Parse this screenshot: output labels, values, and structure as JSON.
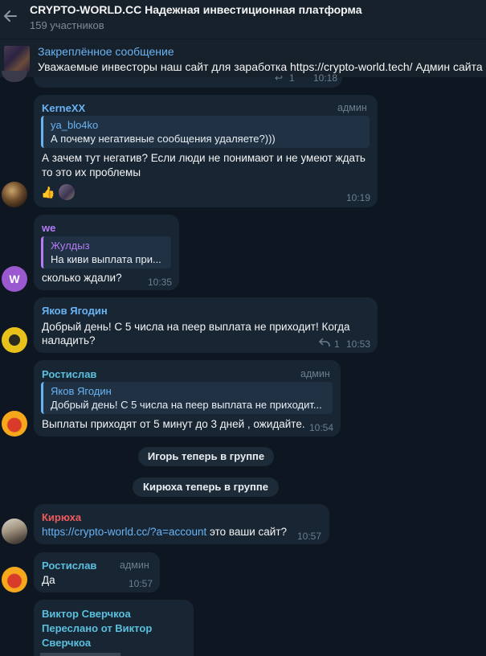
{
  "header": {
    "title": "CRYPTO-WORLD.CC Надежная инвестиционная платформа",
    "subtitle": "159 участников"
  },
  "pinned": {
    "title": "Закреплённое сообщение",
    "text": "Уважаемые инвесторы наш сайт для заработка https://crypto-world.tech/ Админ сайта https://"
  },
  "messages": {
    "top_partial": {
      "reply_count": "1",
      "time": "10:18"
    },
    "m1": {
      "sender": "KerneXX",
      "badge": "админ",
      "quote_name": "ya_blo4ko",
      "quote_text": "А почему негативные сообщения удаляете?)))",
      "line1": "А зачем тут негатив? Если люди не понимают и не умеют ждать",
      "line2": "то это их проблемы",
      "reaction1": "👍",
      "time": "10:19"
    },
    "m2": {
      "sender": "we",
      "avatar_letter": "W",
      "quote_name": "Жулдыз",
      "quote_text": "На киви выплата при...",
      "text": "сколько ждали?",
      "time": "10:35"
    },
    "m3": {
      "sender": "Яков Ягодин",
      "line1": "Добрый день! С 5 числа на пеер выплата не приходит! Когда",
      "line2": "наладить?",
      "reply_count": "1",
      "time": "10:53"
    },
    "m4": {
      "sender": "Ростислав",
      "badge": "админ",
      "quote_name": "Яков Ягодин",
      "quote_text": "Добрый день! С 5 числа на пеер выплата не приходит...",
      "text": "Выплаты приходят от 5 минут до 3 дней , ожидайте.",
      "time": "10:54"
    },
    "service1": "Игорь теперь в группе",
    "service2": "Кирюха теперь в группе",
    "m5": {
      "sender": "Кирюха",
      "link": "https://crypto-world.cc/?a=account",
      "text_after": " это ваши сайт?",
      "time": "10:57"
    },
    "m6": {
      "sender": "Ростислав",
      "badge": "админ",
      "text": "Да",
      "time": "10:57"
    },
    "m7": {
      "sender": "Виктор Сверчкоа",
      "forwarded_line1": "Переслано от Виктор",
      "forwarded_line2": "Сверчкоа"
    }
  },
  "colors": {
    "background": "#0e1621",
    "bubble": "#182533",
    "accent": "#6ab3f3",
    "name_purple": "#b57cf5",
    "name_red": "#ef5b5b",
    "name_blue": "#6ab3f3",
    "name_teal": "#5bc0de"
  },
  "icons": [
    "back-arrow-icon",
    "reply-arrow-icon",
    "thumbs-up-icon"
  ]
}
